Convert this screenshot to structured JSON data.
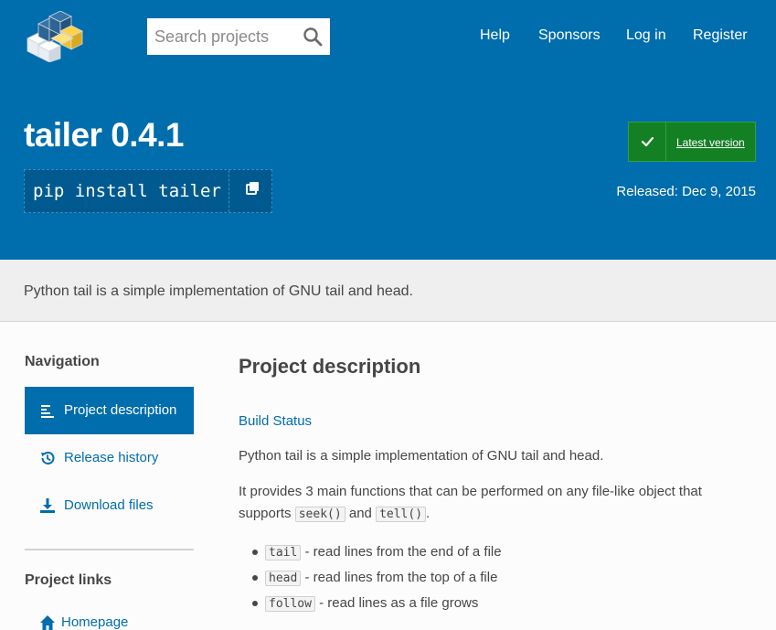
{
  "header": {
    "search_placeholder": "Search projects",
    "nav": [
      "Help",
      "Sponsors",
      "Log in",
      "Register"
    ]
  },
  "hero": {
    "title": "tailer 0.4.1",
    "pip_command": "pip install tailer",
    "latest_label": "Latest version",
    "released": "Released: Dec 9, 2015"
  },
  "summary": "Python tail is a simple implementation of GNU tail and head.",
  "sidebar": {
    "navigation_heading": "Navigation",
    "items": [
      {
        "label": "Project description",
        "icon": "align-left-icon",
        "active": true
      },
      {
        "label": "Release history",
        "icon": "history-icon",
        "active": false
      },
      {
        "label": "Download files",
        "icon": "download-icon",
        "active": false
      }
    ],
    "links_heading": "Project links",
    "homepage": "Homepage"
  },
  "main": {
    "heading": "Project description",
    "build_status": "Build Status",
    "intro": "Python tail is a simple implementation of GNU tail and head.",
    "p2_text": "It provides 3 main functions that can be performed on any file-like object that supports",
    "p2_code1": "seek()",
    "p2_and": "and",
    "p2_code2": "tell()",
    "p2_end": ".",
    "functions": [
      {
        "code": "tail",
        "desc": "- read lines from the end of a file"
      },
      {
        "code": "head",
        "desc": "- read lines from the top of a file"
      },
      {
        "code": "follow",
        "desc": "- read lines as a file grows"
      }
    ]
  },
  "colors": {
    "brand_blue": "#006dad",
    "latest_green": "#148024",
    "summary_bg": "#efefef"
  }
}
